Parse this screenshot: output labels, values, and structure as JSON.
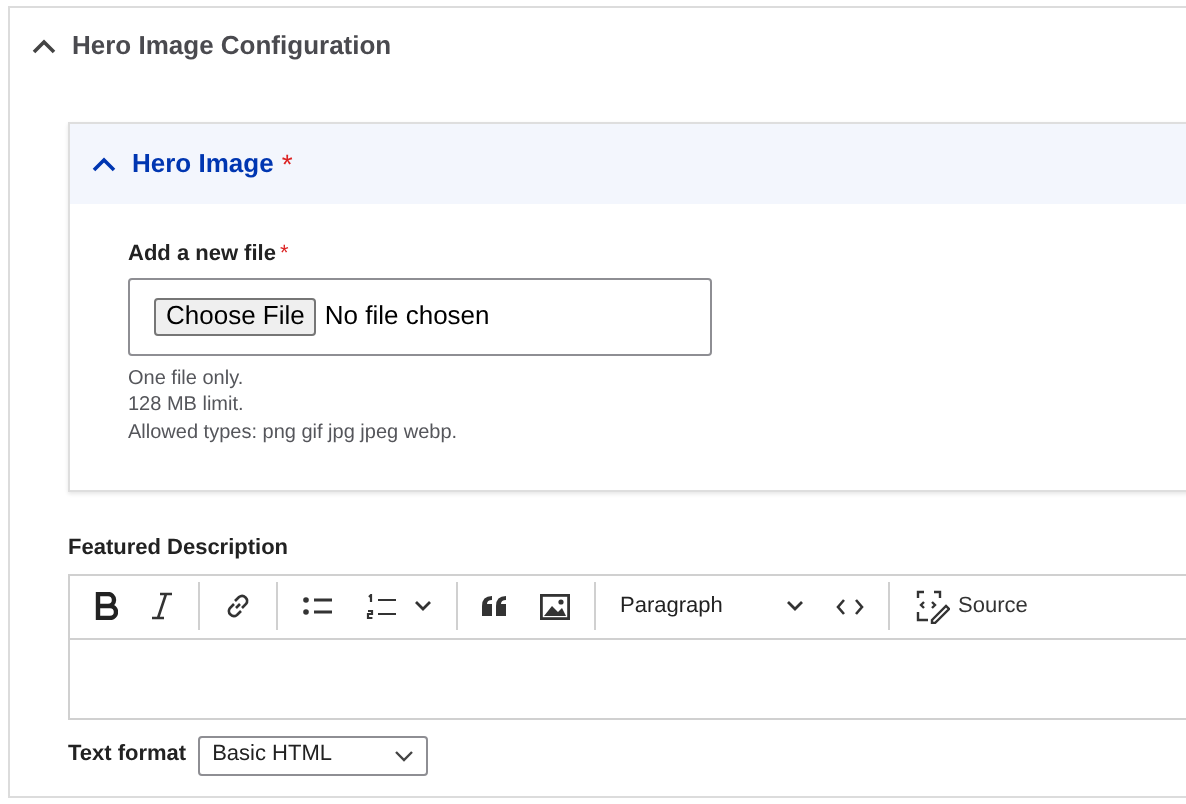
{
  "section": {
    "title": "Hero Image Configuration",
    "expanded": true
  },
  "hero_image": {
    "title": "Hero Image",
    "required_mark": "*",
    "expanded": true,
    "file_field": {
      "label": "Add a new file",
      "required_mark": "*",
      "button": "Choose File",
      "status": "No file chosen",
      "hints": [
        "One file only.",
        "128 MB limit.",
        "Allowed types: png gif jpg jpeg webp."
      ]
    }
  },
  "featured_description": {
    "label": "Featured Description",
    "toolbar": [
      {
        "kind": "bold"
      },
      {
        "kind": "italic"
      },
      {
        "kind": "separator"
      },
      {
        "kind": "link"
      },
      {
        "kind": "separator"
      },
      {
        "kind": "bulleted-list"
      },
      {
        "kind": "numbered-list"
      },
      {
        "kind": "separator"
      },
      {
        "kind": "blockquote"
      },
      {
        "kind": "image"
      },
      {
        "kind": "separator"
      },
      {
        "kind": "heading-select",
        "label": "Paragraph"
      },
      {
        "kind": "code"
      },
      {
        "kind": "separator"
      },
      {
        "kind": "source",
        "label": "Source"
      }
    ],
    "text_format": {
      "label": "Text format",
      "value": "Basic HTML"
    }
  }
}
